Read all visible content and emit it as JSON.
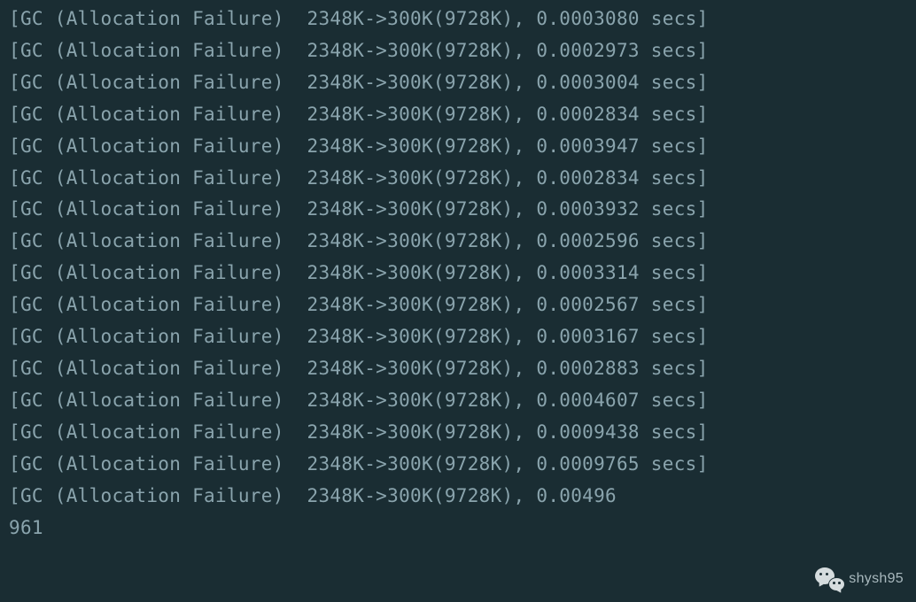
{
  "log": {
    "prefix": "[GC (Allocation Failure)  2348K->300K(9728K), ",
    "suffix": " secs]",
    "entries": [
      "0.0003080",
      "0.0002973",
      "0.0003004",
      "0.0002834",
      "0.0003947",
      "0.0002834",
      "0.0003932",
      "0.0002596",
      "0.0003314",
      "0.0002567",
      "0.0003167",
      "0.0002883",
      "0.0004607",
      "0.0009438",
      "0.0009765"
    ],
    "partial_line": "[GC (Allocation Failure)  2348K->300K(9728K), 0.00496",
    "trailing": "961"
  },
  "watermark": {
    "text": "shysh95"
  }
}
